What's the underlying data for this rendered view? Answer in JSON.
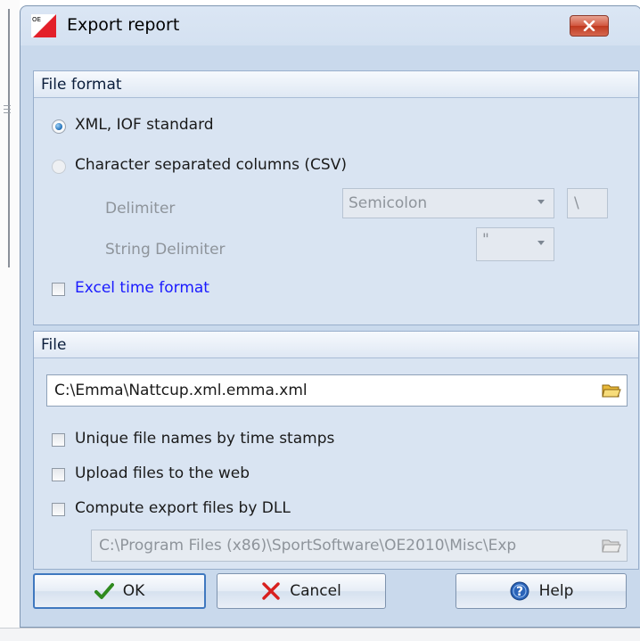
{
  "window": {
    "title": "Export report",
    "app_icon": "oe-app-icon",
    "close_icon": "close-icon"
  },
  "file_format": {
    "header": "File format",
    "option_xml": {
      "label": "XML, IOF standard",
      "selected": true
    },
    "option_csv": {
      "label": "Character separated columns (CSV)",
      "selected": false
    },
    "delimiter": {
      "label": "Delimiter",
      "value": "Semicolon",
      "extra_value": "\\"
    },
    "string_delimiter": {
      "label": "String Delimiter",
      "value": "\""
    },
    "excel_time_format": {
      "label": "Excel time format",
      "checked": false
    }
  },
  "file": {
    "header": "File",
    "path": "C:\\Emma\\Nattcup.xml.emma.xml",
    "unique_names": {
      "label": "Unique file names by time stamps",
      "checked": false
    },
    "upload_web": {
      "label": "Upload files to the web",
      "checked": false
    },
    "compute_dll": {
      "label": "Compute export files by DLL",
      "checked": false
    },
    "dll_path": "C:\\Program Files (x86)\\SportSoftware\\OE2010\\Misc\\Exp"
  },
  "buttons": {
    "ok": "OK",
    "cancel": "Cancel",
    "help": "Help"
  },
  "colors": {
    "dialog_bg": "#c9d9ec",
    "panel_bg": "#d9e4f2",
    "link_blue": "#1a1aff",
    "disabled_text": "#8e949b",
    "close_red": "#c0391f"
  }
}
